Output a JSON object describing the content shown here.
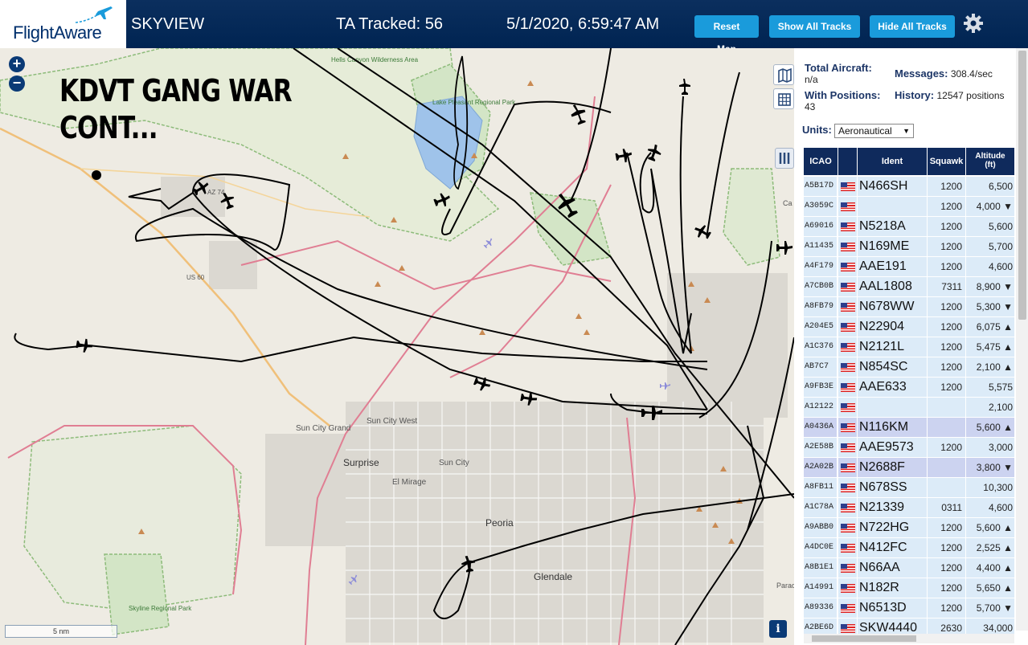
{
  "header": {
    "logo_text": "FlightAware",
    "app_name": "SKYVIEW",
    "tracked": "TA Tracked: 56",
    "datetime": "5/1/2020, 6:59:47 AM",
    "buttons": {
      "reset": "Reset Map",
      "show_all": "Show All Tracks",
      "hide_all": "Hide All Tracks"
    }
  },
  "map": {
    "annotation_line1": "KDVT GANG WAR",
    "annotation_line2": "CONT...",
    "zoom_in": "+",
    "zoom_out": "−",
    "scale": "5 nm",
    "info": "i",
    "labels": {
      "hells": "Hells Canyon Wilderness Area",
      "lake": "Lake Pleasant Regional Park",
      "az74": "AZ 74",
      "us60": "US 60",
      "suncitygrand": "Sun City Grand",
      "suncitywest": "Sun City West",
      "surprise": "Surprise",
      "suncity": "Sun City",
      "elmirage": "El Mirage",
      "peoria": "Peoria",
      "glendale": "Glendale",
      "skyline": "Skyline Regional Park",
      "cave": "Ca",
      "para": "Parad"
    }
  },
  "stats": {
    "total_label": "Total Aircraft:",
    "total_value": "n/a",
    "messages_label": "Messages:",
    "messages_value": "308.4/sec",
    "positions_label": "With Positions:",
    "positions_value": "43",
    "history_label": "History:",
    "history_value": "12547 positions"
  },
  "units": {
    "label": "Units:",
    "value": "Aeronautical"
  },
  "table": {
    "headers": {
      "icao": "ICAO",
      "ident": "Ident",
      "squawk": "Squawk",
      "alt1": "Altitude",
      "alt2": "(ft)"
    },
    "rows": [
      {
        "icao": "A5B17D",
        "ident": "N466SH",
        "squawk": "1200",
        "alt": "6,500"
      },
      {
        "icao": "A3059C",
        "ident": "",
        "squawk": "1200",
        "alt": "4,000 ▼"
      },
      {
        "icao": "A69016",
        "ident": "N5218A",
        "squawk": "1200",
        "alt": "5,600"
      },
      {
        "icao": "A11435",
        "ident": "N169ME",
        "squawk": "1200",
        "alt": "5,700"
      },
      {
        "icao": "A4F179",
        "ident": "AAE191",
        "squawk": "1200",
        "alt": "4,600"
      },
      {
        "icao": "A7CB0B",
        "ident": "AAL1808",
        "squawk": "7311",
        "alt": "8,900 ▼"
      },
      {
        "icao": "A8FB79",
        "ident": "N678WW",
        "squawk": "1200",
        "alt": "5,300 ▼"
      },
      {
        "icao": "A204E5",
        "ident": "N22904",
        "squawk": "1200",
        "alt": "6,075 ▲"
      },
      {
        "icao": "A1C376",
        "ident": "N2121L",
        "squawk": "1200",
        "alt": "5,475 ▲"
      },
      {
        "icao": "AB7C7",
        "ident": "N854SC",
        "squawk": "1200",
        "alt": "2,100 ▲"
      },
      {
        "icao": "A9FB3E",
        "ident": "AAE633",
        "squawk": "1200",
        "alt": "5,575"
      },
      {
        "icao": "A12122",
        "ident": "",
        "squawk": "",
        "alt": "2,100"
      },
      {
        "icao": "A0436A",
        "ident": "N116KM",
        "squawk": "",
        "alt": "5,600 ▲"
      },
      {
        "icao": "A2E58B",
        "ident": "AAE9573",
        "squawk": "1200",
        "alt": "3,000"
      },
      {
        "icao": "A2A02B",
        "ident": "N2688F",
        "squawk": "",
        "alt": "3,800 ▼"
      },
      {
        "icao": "A8FB11",
        "ident": "N678SS",
        "squawk": "",
        "alt": "10,300"
      },
      {
        "icao": "A1C78A",
        "ident": "N21339",
        "squawk": "0311",
        "alt": "4,600"
      },
      {
        "icao": "A9ABB0",
        "ident": "N722HG",
        "squawk": "1200",
        "alt": "5,600 ▲"
      },
      {
        "icao": "A4DC0E",
        "ident": "N412FC",
        "squawk": "1200",
        "alt": "2,525 ▲"
      },
      {
        "icao": "A8B1E1",
        "ident": "N66AA",
        "squawk": "1200",
        "alt": "4,400 ▲"
      },
      {
        "icao": "A14991",
        "ident": "N182R",
        "squawk": "1200",
        "alt": "5,650 ▲"
      },
      {
        "icao": "A89336",
        "ident": "N6513D",
        "squawk": "1200",
        "alt": "5,700 ▼"
      },
      {
        "icao": "A2BE6D",
        "ident": "SKW4440",
        "squawk": "2630",
        "alt": "34,000"
      }
    ]
  }
}
